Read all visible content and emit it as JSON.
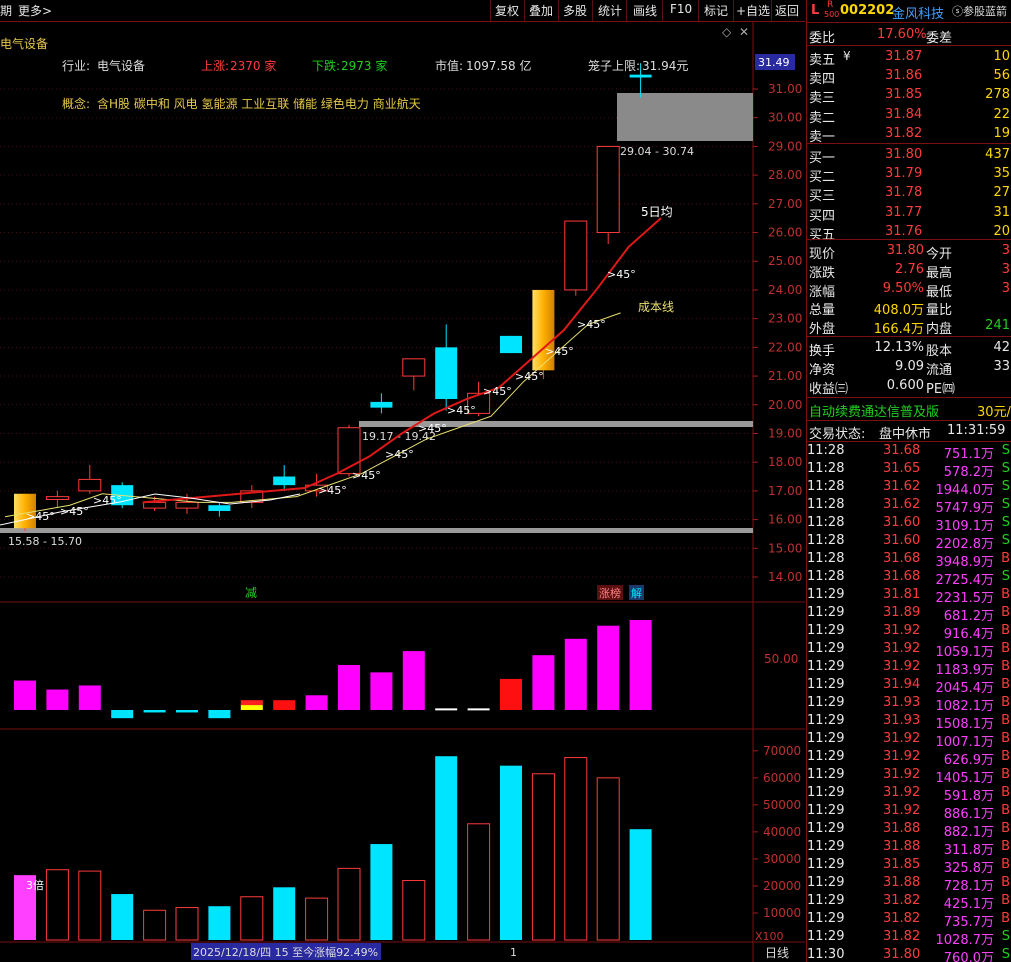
{
  "toolbar": {
    "left_cut": "期",
    "more": "更多>",
    "buttons": [
      "复权",
      "叠加",
      "多股",
      "统计",
      "画线",
      "F10",
      "标记",
      "+自选",
      "返回"
    ]
  },
  "chart_header": {
    "title": "电气设备",
    "industry_label": "行业:",
    "industry_value": "电气设备",
    "up_label": "上涨:",
    "up_value": "2370 家",
    "down_label": "下跌:",
    "down_value": "2973 家",
    "mktcap_label": "市值:",
    "mktcap_value": "1097.58 亿",
    "cage_label": "笼子上限:",
    "cage_value": "31.94元",
    "concept_label": "概念:",
    "concept_value": "含H股 碳中和 风电 氢能源 工业互联 储能 绿色电力 商业航天"
  },
  "annotations": {
    "ma5": "5日均",
    "cost_line": "成本线",
    "zone_top": "29.04 - 30.74",
    "zone_mid": "19.17 - 19.42",
    "zone_bot": "15.58 - 15.70",
    "angle": ">45°",
    "marker_reduce": "减",
    "marker_limit": "涨榜",
    "marker_solve": "解",
    "vol_multiple": "3倍",
    "date_range": "2025/12/18/四 15 至今涨幅92.49%",
    "vol_mult_axis": "X100",
    "period": "日线",
    "cursor_num": "1"
  },
  "price_axis": {
    "current": "31.49",
    "ticks": [
      "31.00",
      "30.00",
      "29.00",
      "28.00",
      "27.00",
      "26.00",
      "25.00",
      "24.00",
      "23.00",
      "22.00",
      "21.00",
      "20.00",
      "19.00",
      "18.00",
      "17.00",
      "16.00",
      "15.00",
      "14.00"
    ]
  },
  "mid_axis": {
    "ticks": [
      "50.00"
    ]
  },
  "vol_axis": {
    "ticks": [
      "70000",
      "60000",
      "50000",
      "40000",
      "30000",
      "20000",
      "10000"
    ]
  },
  "chart_data": {
    "type": "candlestick",
    "ylim": [
      13.6,
      32.6
    ],
    "candles": [
      {
        "o": 15.7,
        "c": 16.9,
        "h": 16.9,
        "l": 15.6,
        "up": true,
        "limit": true
      },
      {
        "o": 16.8,
        "c": 16.7,
        "h": 17.0,
        "l": 16.4,
        "up": true
      },
      {
        "o": 17.4,
        "c": 17.0,
        "h": 17.9,
        "l": 16.9,
        "up": true
      },
      {
        "o": 17.2,
        "c": 16.5,
        "h": 17.3,
        "l": 16.4,
        "up": false
      },
      {
        "o": 16.6,
        "c": 16.4,
        "h": 16.8,
        "l": 16.3,
        "up": true
      },
      {
        "o": 16.6,
        "c": 16.4,
        "h": 16.9,
        "l": 16.2,
        "up": true
      },
      {
        "o": 16.5,
        "c": 16.3,
        "h": 16.6,
        "l": 16.1,
        "up": false
      },
      {
        "o": 16.6,
        "c": 17.0,
        "h": 17.2,
        "l": 16.4,
        "up": true
      },
      {
        "o": 17.5,
        "c": 17.2,
        "h": 17.9,
        "l": 17.0,
        "up": false
      },
      {
        "o": 17.0,
        "c": 17.2,
        "h": 17.6,
        "l": 16.8,
        "up": true
      },
      {
        "o": 17.6,
        "c": 19.2,
        "h": 19.3,
        "l": 17.5,
        "up": true
      },
      {
        "o": 19.9,
        "c": 20.1,
        "h": 20.4,
        "l": 19.7,
        "up": false
      },
      {
        "o": 21.0,
        "c": 21.6,
        "h": 21.6,
        "l": 20.5,
        "up": true
      },
      {
        "o": 22.0,
        "c": 20.2,
        "h": 22.8,
        "l": 19.8,
        "up": false
      },
      {
        "o": 19.7,
        "c": 20.4,
        "h": 20.8,
        "l": 19.6,
        "up": true
      },
      {
        "o": 21.8,
        "c": 22.4,
        "h": 22.4,
        "l": 21.8,
        "up": false
      },
      {
        "o": 21.2,
        "c": 24.0,
        "h": 24.0,
        "l": 20.9,
        "up": true,
        "limit": true
      },
      {
        "o": 24.0,
        "c": 26.4,
        "h": 26.4,
        "l": 23.8,
        "up": true
      },
      {
        "o": 26.0,
        "c": 29.0,
        "h": 29.0,
        "l": 25.6,
        "up": true
      },
      {
        "o": 31.4,
        "c": 31.5,
        "h": 31.9,
        "l": 30.7,
        "up": false
      }
    ],
    "ma5": [
      null,
      null,
      null,
      null,
      16.6,
      16.7,
      16.8,
      16.9,
      17.0,
      17.1,
      17.6,
      18.2,
      19.0,
      19.7,
      20.2,
      20.6,
      21.6,
      22.6,
      24.0,
      25.5,
      26.5
    ],
    "cost_line": [
      16.1,
      16.3,
      16.5,
      16.9,
      16.8,
      16.7,
      16.6,
      16.6,
      16.7,
      16.8,
      17.2,
      17.6,
      18.2,
      18.8,
      19.2,
      19.6,
      20.8,
      21.8,
      22.8,
      23.2
    ],
    "mid_bars": [
      {
        "v": 36,
        "c": "mag"
      },
      {
        "v": 25,
        "c": "mag"
      },
      {
        "v": 30,
        "c": "mag"
      },
      {
        "v": -10,
        "c": "cyan"
      },
      {
        "v": -3,
        "c": "cyan"
      },
      {
        "v": -3,
        "c": "cyan"
      },
      {
        "v": -10,
        "c": "cyan"
      },
      {
        "v": 12,
        "c": "ryy"
      },
      {
        "v": 12,
        "c": "red"
      },
      {
        "v": 18,
        "c": "mag"
      },
      {
        "v": 55,
        "c": "mag"
      },
      {
        "v": 46,
        "c": "mag"
      },
      {
        "v": 72,
        "c": "mag"
      },
      {
        "v": 2,
        "c": "wht"
      },
      {
        "v": 2,
        "c": "wht"
      },
      {
        "v": 38,
        "c": "red"
      },
      {
        "v": 67,
        "c": "mag"
      },
      {
        "v": 87,
        "c": "mag"
      },
      {
        "v": 103,
        "c": "mag"
      },
      {
        "v": 110,
        "c": "mag"
      }
    ],
    "mid_ylim": [
      -30,
      150
    ],
    "volumes": [
      {
        "v": 24000,
        "c": "mag"
      },
      {
        "v": 26000,
        "c": "red"
      },
      {
        "v": 25500,
        "c": "red"
      },
      {
        "v": 17000,
        "c": "cyan"
      },
      {
        "v": 11000,
        "c": "red"
      },
      {
        "v": 12000,
        "c": "red"
      },
      {
        "v": 12500,
        "c": "cyan"
      },
      {
        "v": 16000,
        "c": "red"
      },
      {
        "v": 19500,
        "c": "cyan"
      },
      {
        "v": 15500,
        "c": "red"
      },
      {
        "v": 26500,
        "c": "red"
      },
      {
        "v": 35500,
        "c": "cyan"
      },
      {
        "v": 22000,
        "c": "red"
      },
      {
        "v": 68000,
        "c": "cyan"
      },
      {
        "v": 43000,
        "c": "red"
      },
      {
        "v": 64500,
        "c": "cyan"
      },
      {
        "v": 61500,
        "c": "red"
      },
      {
        "v": 67500,
        "c": "red"
      },
      {
        "v": 60000,
        "c": "red"
      },
      {
        "v": 41000,
        "c": "cyan"
      }
    ],
    "vol_ylim": [
      0,
      74000
    ]
  },
  "quote": {
    "flag": "L",
    "code_r": "R",
    "code_sub": "500",
    "code": "002202",
    "name": "金风科技",
    "tip": "参股蓝箭",
    "weibi_label": "委比",
    "weibi_value": "17.60%",
    "weicha_label": "委差",
    "asks": [
      {
        "label": "卖五",
        "price": "31.87",
        "vol": "10"
      },
      {
        "label": "卖四",
        "price": "31.86",
        "vol": "56"
      },
      {
        "label": "卖三",
        "price": "31.85",
        "vol": "278"
      },
      {
        "label": "卖二",
        "price": "31.84",
        "vol": "22"
      },
      {
        "label": "卖一",
        "price": "31.82",
        "vol": "19"
      }
    ],
    "bids": [
      {
        "label": "买一",
        "price": "31.80",
        "vol": "437"
      },
      {
        "label": "买二",
        "price": "31.79",
        "vol": "35"
      },
      {
        "label": "买三",
        "price": "31.78",
        "vol": "27"
      },
      {
        "label": "买四",
        "price": "31.77",
        "vol": "31"
      },
      {
        "label": "买五",
        "price": "31.76",
        "vol": "20"
      }
    ],
    "ask_mark": "¥",
    "stats": [
      {
        "l": "现价",
        "v": "31.80",
        "r": "今开",
        "rv": "3"
      },
      {
        "l": "涨跌",
        "v": "2.76",
        "r": "最高",
        "rv": "3"
      },
      {
        "l": "涨幅",
        "v": "9.50%",
        "r": "最低",
        "rv": "3"
      },
      {
        "l": "总量",
        "v": "408.0万",
        "r": "量比",
        "rv": ""
      },
      {
        "l": "外盘",
        "v": "166.4万",
        "r": "内盘",
        "rv": "241"
      }
    ],
    "stats2": [
      {
        "l": "换手",
        "v": "12.13%",
        "r": "股本",
        "rv": "42"
      },
      {
        "l": "净资",
        "v": "9.09",
        "r": "流通",
        "rv": "33"
      },
      {
        "l": "收益㈢",
        "v": "0.600",
        "r": "PE㈣",
        "rv": ""
      }
    ],
    "promo": "自动续费通达信普及版",
    "promo_price": "30元/",
    "status_label": "交易状态:",
    "status_value": "盘中休市",
    "status_time": "11:31:59"
  },
  "ticks": [
    {
      "t": "11:28",
      "p": "31.68",
      "a": "751.1万",
      "s": "S"
    },
    {
      "t": "11:28",
      "p": "31.65",
      "a": "578.2万",
      "s": "S"
    },
    {
      "t": "11:28",
      "p": "31.62",
      "a": "1944.0万",
      "s": "S"
    },
    {
      "t": "11:28",
      "p": "31.62",
      "a": "5747.9万",
      "s": "S"
    },
    {
      "t": "11:28",
      "p": "31.60",
      "a": "3109.1万",
      "s": "S"
    },
    {
      "t": "11:28",
      "p": "31.60",
      "a": "2202.8万",
      "s": "S"
    },
    {
      "t": "11:28",
      "p": "31.68",
      "a": "3948.9万",
      "s": "B"
    },
    {
      "t": "11:28",
      "p": "31.68",
      "a": "2725.4万",
      "s": "S"
    },
    {
      "t": "11:29",
      "p": "31.81",
      "a": "2231.5万",
      "s": "B"
    },
    {
      "t": "11:29",
      "p": "31.89",
      "a": "681.2万",
      "s": "B"
    },
    {
      "t": "11:29",
      "p": "31.92",
      "a": "916.4万",
      "s": "B"
    },
    {
      "t": "11:29",
      "p": "31.92",
      "a": "1059.1万",
      "s": "B"
    },
    {
      "t": "11:29",
      "p": "31.92",
      "a": "1183.9万",
      "s": "B"
    },
    {
      "t": "11:29",
      "p": "31.94",
      "a": "2045.4万",
      "s": "B"
    },
    {
      "t": "11:29",
      "p": "31.93",
      "a": "1082.1万",
      "s": "B"
    },
    {
      "t": "11:29",
      "p": "31.93",
      "a": "1508.1万",
      "s": "B"
    },
    {
      "t": "11:29",
      "p": "31.92",
      "a": "1007.1万",
      "s": "B"
    },
    {
      "t": "11:29",
      "p": "31.92",
      "a": "626.9万",
      "s": "B"
    },
    {
      "t": "11:29",
      "p": "31.92",
      "a": "1405.1万",
      "s": "B"
    },
    {
      "t": "11:29",
      "p": "31.92",
      "a": "591.8万",
      "s": "B"
    },
    {
      "t": "11:29",
      "p": "31.92",
      "a": "886.1万",
      "s": "B"
    },
    {
      "t": "11:29",
      "p": "31.88",
      "a": "882.1万",
      "s": "B"
    },
    {
      "t": "11:29",
      "p": "31.88",
      "a": "311.8万",
      "s": "B"
    },
    {
      "t": "11:29",
      "p": "31.85",
      "a": "325.8万",
      "s": "B"
    },
    {
      "t": "11:29",
      "p": "31.88",
      "a": "728.1万",
      "s": "B"
    },
    {
      "t": "11:29",
      "p": "31.82",
      "a": "425.1万",
      "s": "B"
    },
    {
      "t": "11:29",
      "p": "31.82",
      "a": "735.7万",
      "s": "B"
    },
    {
      "t": "11:29",
      "p": "31.82",
      "a": "1028.7万",
      "s": "S"
    },
    {
      "t": "11:30",
      "p": "31.80",
      "a": "760.0万",
      "s": "S"
    }
  ],
  "colors": {
    "up": "#ff3b3b",
    "down": "#00e5ff",
    "bg": "#000000",
    "grid": "#5a1010",
    "ma5": "#e01818",
    "cost": "#e8e070"
  }
}
